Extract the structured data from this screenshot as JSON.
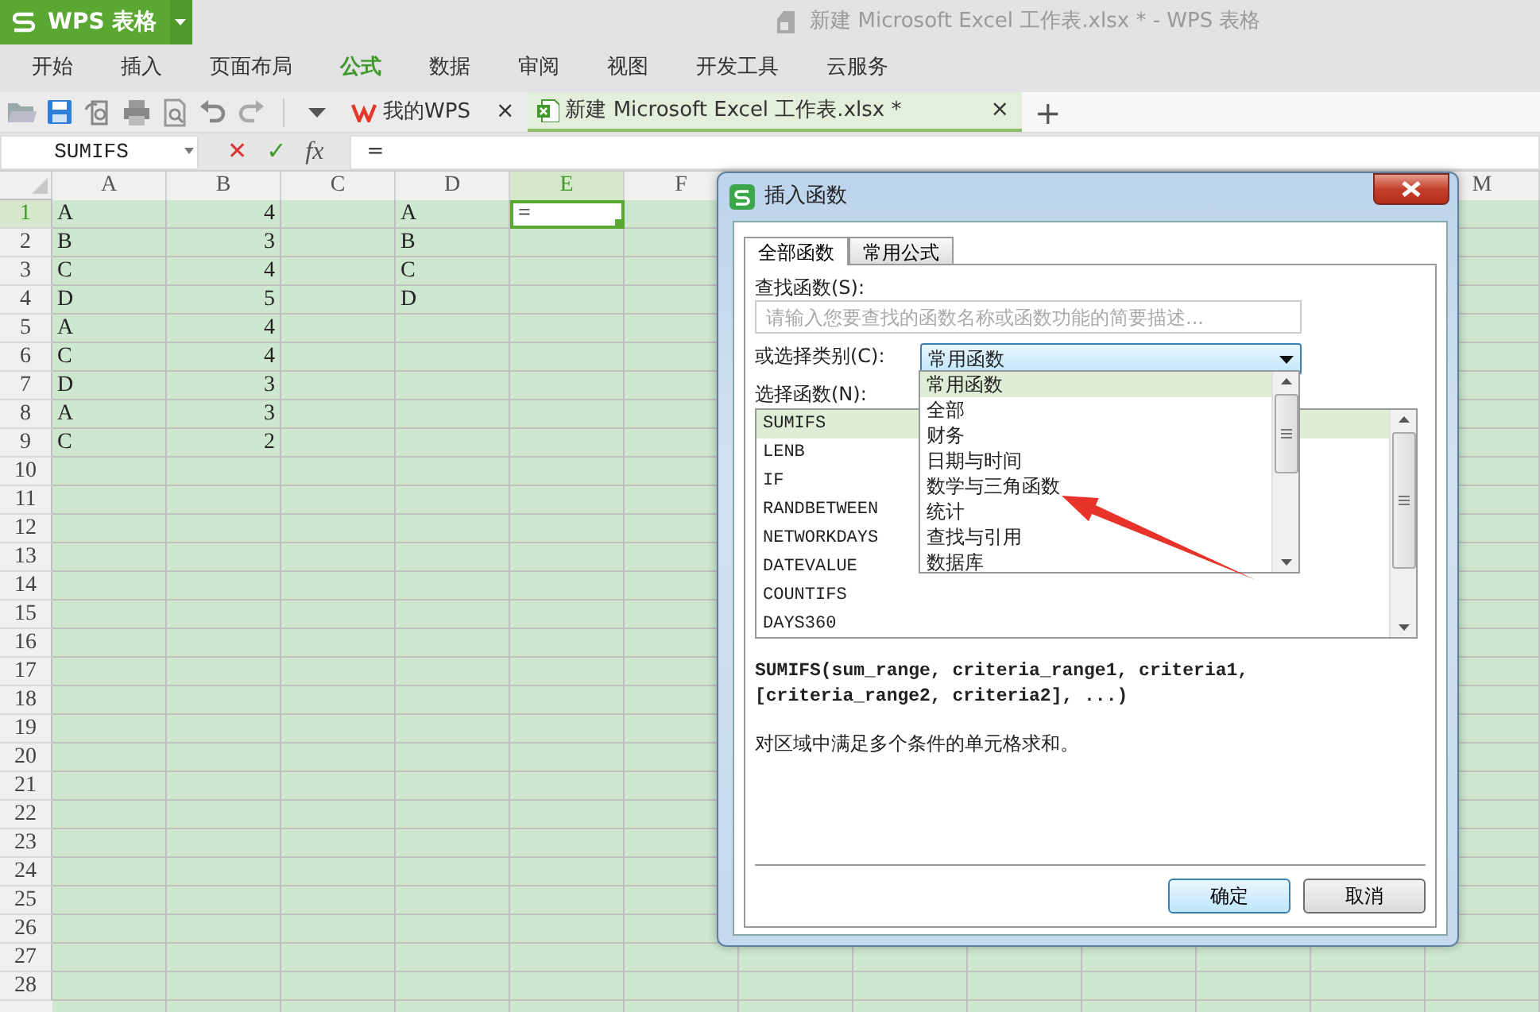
{
  "app": {
    "name": "WPS 表格",
    "title": "新建 Microsoft Excel 工作表.xlsx * - WPS 表格"
  },
  "menu": [
    {
      "label": "开始",
      "selected": false
    },
    {
      "label": "插入",
      "selected": false
    },
    {
      "label": "页面布局",
      "selected": false
    },
    {
      "label": "公式",
      "selected": true
    },
    {
      "label": "数据",
      "selected": false
    },
    {
      "label": "审阅",
      "selected": false
    },
    {
      "label": "视图",
      "selected": false
    },
    {
      "label": "开发工具",
      "selected": false
    },
    {
      "label": "云服务",
      "selected": false
    }
  ],
  "doc_tabs": [
    {
      "label": "我的WPS",
      "close": "×",
      "selected": false,
      "kind": "home"
    },
    {
      "label": "新建 Microsoft Excel 工作表.xlsx *",
      "close": "×",
      "selected": true,
      "kind": "sheet"
    }
  ],
  "new_tab": "+",
  "formula_bar": {
    "name_box": "SUMIFS",
    "cancel": "✕",
    "enter": "✓",
    "fx": "fx",
    "value": "="
  },
  "columns": [
    {
      "label": "A",
      "highlighted": false
    },
    {
      "label": "B",
      "highlighted": false
    },
    {
      "label": "C",
      "highlighted": false
    },
    {
      "label": "D",
      "highlighted": false
    },
    {
      "label": "E",
      "highlighted": true
    },
    {
      "label": "F",
      "highlighted": false
    },
    {
      "label": "M",
      "highlighted": false
    }
  ],
  "rows": [
    {
      "number": "1",
      "highlighted": true,
      "cells": [
        {
          "text": "A",
          "kind": "text",
          "selected": false
        },
        {
          "text": "4",
          "kind": "number",
          "selected": false
        },
        null,
        {
          "text": "A",
          "kind": "text",
          "selected": false
        },
        {
          "text": "=",
          "kind": "text",
          "selected": true
        }
      ]
    },
    {
      "number": "2",
      "highlighted": false,
      "cells": [
        {
          "text": "B",
          "kind": "text",
          "selected": false
        },
        {
          "text": "3",
          "kind": "number",
          "selected": false
        },
        null,
        {
          "text": "B",
          "kind": "text",
          "selected": false
        }
      ]
    },
    {
      "number": "3",
      "highlighted": false,
      "cells": [
        {
          "text": "C",
          "kind": "text",
          "selected": false
        },
        {
          "text": "4",
          "kind": "number",
          "selected": false
        },
        null,
        {
          "text": "C",
          "kind": "text",
          "selected": false
        }
      ]
    },
    {
      "number": "4",
      "highlighted": false,
      "cells": [
        {
          "text": "D",
          "kind": "text",
          "selected": false
        },
        {
          "text": "5",
          "kind": "number",
          "selected": false
        },
        null,
        {
          "text": "D",
          "kind": "text",
          "selected": false
        }
      ]
    },
    {
      "number": "5",
      "highlighted": false,
      "cells": [
        {
          "text": "A",
          "kind": "text",
          "selected": false
        },
        {
          "text": "4",
          "kind": "number",
          "selected": false
        }
      ]
    },
    {
      "number": "6",
      "highlighted": false,
      "cells": [
        {
          "text": "C",
          "kind": "text",
          "selected": false
        },
        {
          "text": "4",
          "kind": "number",
          "selected": false
        }
      ]
    },
    {
      "number": "7",
      "highlighted": false,
      "cells": [
        {
          "text": "D",
          "kind": "text",
          "selected": false
        },
        {
          "text": "3",
          "kind": "number",
          "selected": false
        }
      ]
    },
    {
      "number": "8",
      "highlighted": false,
      "cells": [
        {
          "text": "A",
          "kind": "text",
          "selected": false
        },
        {
          "text": "3",
          "kind": "number",
          "selected": false
        }
      ]
    },
    {
      "number": "9",
      "highlighted": false,
      "cells": [
        {
          "text": "C",
          "kind": "text",
          "selected": false
        },
        {
          "text": "2",
          "kind": "number",
          "selected": false
        }
      ]
    },
    {
      "number": "10",
      "highlighted": false
    },
    {
      "number": "11",
      "highlighted": false
    },
    {
      "number": "12",
      "highlighted": false
    },
    {
      "number": "13",
      "highlighted": false
    },
    {
      "number": "14",
      "highlighted": false
    },
    {
      "number": "15",
      "highlighted": false
    },
    {
      "number": "16",
      "highlighted": false
    },
    {
      "number": "17",
      "highlighted": false
    },
    {
      "number": "18",
      "highlighted": false
    },
    {
      "number": "19",
      "highlighted": false
    },
    {
      "number": "20",
      "highlighted": false
    },
    {
      "number": "21",
      "highlighted": false
    },
    {
      "number": "22",
      "highlighted": false
    },
    {
      "number": "23",
      "highlighted": false
    },
    {
      "number": "24",
      "highlighted": false
    },
    {
      "number": "25",
      "highlighted": false
    },
    {
      "number": "26",
      "highlighted": false
    },
    {
      "number": "27",
      "highlighted": false
    },
    {
      "number": "28",
      "highlighted": false
    }
  ],
  "dialog": {
    "title": "插入函数",
    "tabs": [
      {
        "label": "全部函数",
        "selected": true
      },
      {
        "label": "常用公式",
        "selected": false
      }
    ],
    "search_label": "查找函数(S):",
    "search_placeholder": "请输入您要查找的函数名称或函数功能的简要描述...",
    "category_label": "或选择类别(C):",
    "category_value": "常用函数",
    "category_expanded": true,
    "category_options": [
      {
        "label": "常用函数",
        "selected": true
      },
      {
        "label": "全部",
        "selected": false
      },
      {
        "label": "财务",
        "selected": false
      },
      {
        "label": "日期与时间",
        "selected": false
      },
      {
        "label": "数学与三角函数",
        "selected": false
      },
      {
        "label": "统计",
        "selected": false
      },
      {
        "label": "查找与引用",
        "selected": false
      },
      {
        "label": "数据库",
        "selected": false
      }
    ],
    "function_label": "选择函数(N):",
    "functions": [
      {
        "name": "SUMIFS",
        "selected": true
      },
      {
        "name": "LENB",
        "selected": false
      },
      {
        "name": "IF",
        "selected": false
      },
      {
        "name": "RANDBETWEEN",
        "selected": false
      },
      {
        "name": "NETWORKDAYS",
        "selected": false
      },
      {
        "name": "DATEVALUE",
        "selected": false
      },
      {
        "name": "COUNTIFS",
        "selected": false
      },
      {
        "name": "DAYS360",
        "selected": false
      }
    ],
    "syntax": "SUMIFS(sum_range, criteria_range1, criteria1, [criteria_range2, criteria2], ...)",
    "description": "对区域中满足多个条件的单元格求和。",
    "buttons": [
      {
        "label": "确定",
        "default": true
      },
      {
        "label": "取消",
        "default": false
      }
    ]
  }
}
